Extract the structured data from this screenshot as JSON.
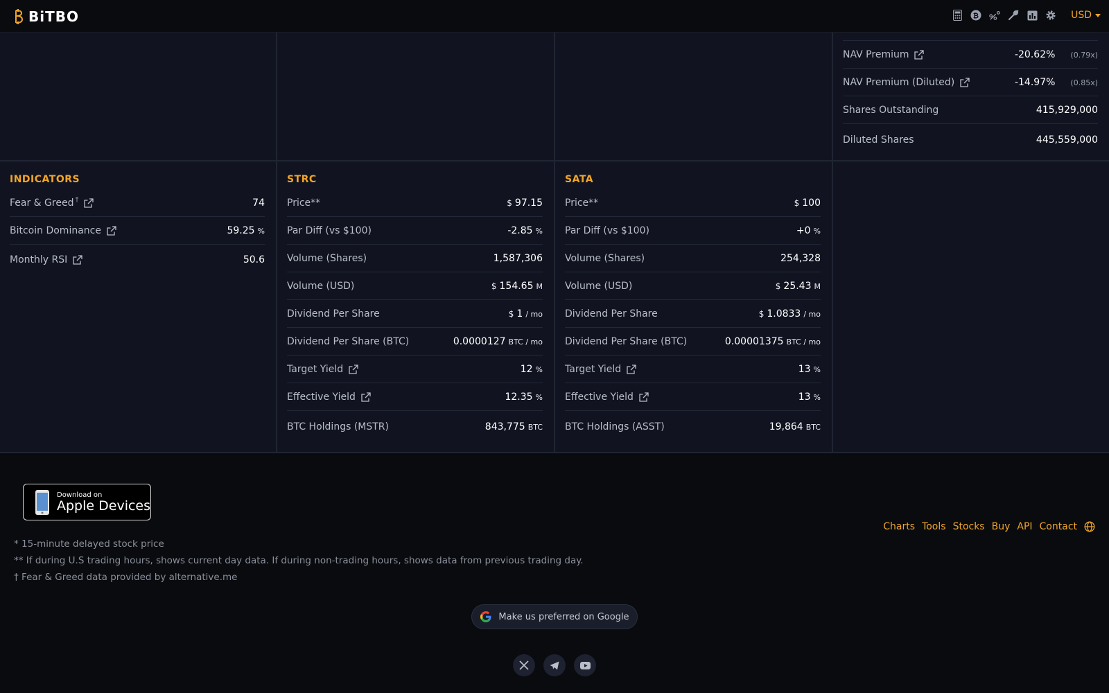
{
  "header": {
    "logo_text": "BiTBO",
    "icons": [
      "calculator-icon",
      "bitcoin-icon",
      "percent-icon",
      "wrench-icon",
      "chart-icon",
      "gear-icon"
    ],
    "currency": "USD",
    "accent": "#f0a52a"
  },
  "top_panel": {
    "rows": [
      {
        "label": "NAV Premium",
        "value": "-20.62%",
        "extra": "(0.79x)"
      },
      {
        "label": "NAV Premium (Diluted)",
        "value": "-14.97%",
        "extra": "(0.85x)"
      },
      {
        "label": "Shares Outstanding",
        "value": "415,929,000"
      },
      {
        "label": "Diluted Shares",
        "value": "445,559,000"
      }
    ]
  },
  "indicators": {
    "title": "INDICATORS",
    "rows": [
      {
        "label": "Fear & Greed",
        "dagger": "†",
        "value": "74"
      },
      {
        "label": "Bitcoin Dominance",
        "value": "59.25",
        "unit": "%"
      },
      {
        "label": "Monthly RSI",
        "value": "50.6"
      }
    ]
  },
  "strc": {
    "title": "STRC",
    "rows": [
      {
        "label": "Price**",
        "cur": "$",
        "value": "97.15"
      },
      {
        "label": "Par Diff (vs $100)",
        "value": "-2.85",
        "unit": "%"
      },
      {
        "label": "Volume (Shares)",
        "value": "1,587,306"
      },
      {
        "label": "Volume (USD)",
        "cur": "$",
        "value": "154.65",
        "unit": "M"
      },
      {
        "label": "Dividend Per Share",
        "cur": "$",
        "value": "1",
        "unit": "/ mo"
      },
      {
        "label": "Dividend Per Share (BTC)",
        "value": "0.0000127",
        "unit": "BTC / mo"
      },
      {
        "label": "Target Yield",
        "value": "12",
        "unit": "%"
      },
      {
        "label": "Effective Yield",
        "value": "12.35",
        "unit": "%"
      },
      {
        "label": "BTC Holdings (MSTR)",
        "value": "843,775",
        "unit": "BTC"
      }
    ]
  },
  "sata": {
    "title": "SATA",
    "rows": [
      {
        "label": "Price**",
        "cur": "$",
        "value": "100"
      },
      {
        "label": "Par Diff (vs $100)",
        "value": "+0",
        "unit": "%"
      },
      {
        "label": "Volume (Shares)",
        "value": "254,328"
      },
      {
        "label": "Volume (USD)",
        "cur": "$",
        "value": "25.43",
        "unit": "M"
      },
      {
        "label": "Dividend Per Share",
        "cur": "$",
        "value": "1.0833",
        "unit": "/ mo"
      },
      {
        "label": "Dividend Per Share (BTC)",
        "value": "0.00001375",
        "unit": "BTC / mo"
      },
      {
        "label": "Target Yield",
        "value": "13",
        "unit": "%"
      },
      {
        "label": "Effective Yield",
        "value": "13",
        "unit": "%"
      },
      {
        "label": "BTC Holdings (ASST)",
        "value": "19,864",
        "unit": "BTC"
      }
    ]
  },
  "footer": {
    "apple_small": "Download on",
    "apple_big": "Apple Devices",
    "notes": [
      "* 15-minute delayed stock price",
      "** If during U.S trading hours, shows current day data. If during non-trading hours, shows data from previous trading day.",
      "† Fear & Greed data provided by alternative.me"
    ],
    "links": [
      "Charts",
      "Tools",
      "Stocks",
      "Buy",
      "API",
      "Contact"
    ],
    "google_button": "Make us preferred on Google",
    "socials": [
      "x-icon",
      "telegram-icon",
      "youtube-icon"
    ]
  }
}
